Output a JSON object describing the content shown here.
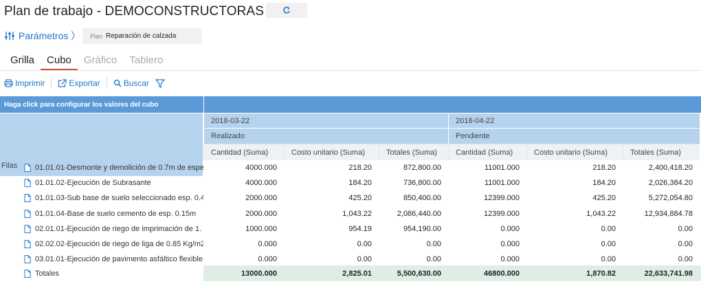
{
  "header": {
    "title": "Plan de trabajo - DEMOCONSTRUCTORAS",
    "params_label": "Parámetros 〉",
    "plan_label": "Plan",
    "plan_value": "Reparación de calzada"
  },
  "tabs": [
    {
      "label": "Grilla",
      "state": "normal"
    },
    {
      "label": "Cubo",
      "state": "active"
    },
    {
      "label": "Gráfico",
      "state": "disabled"
    },
    {
      "label": "Tablero",
      "state": "disabled"
    }
  ],
  "toolbar": {
    "print": "Imprimir",
    "export": "Exportar",
    "search": "Buscar"
  },
  "grid": {
    "config_hint": "Haga click para configurar los valores del cubo",
    "rows_header": "Filas",
    "dates": [
      "2018-03-22",
      "2018-04-22"
    ],
    "statuses": [
      "Realizado",
      "Pendiente"
    ],
    "measures": [
      "Cantidad (Suma)",
      "Costo unitario (Suma)",
      "Totales (Suma)"
    ],
    "rows": [
      {
        "label": "01.01.01-Desmonte y demolición de 0.7m de espe",
        "values": [
          "4000.000",
          "218.20",
          "872,800.00",
          "11001.000",
          "218.20",
          "2,400,418.20"
        ]
      },
      {
        "label": "01.01.02-Ejecución de Subrasante",
        "values": [
          "4000.000",
          "184.20",
          "736,800.00",
          "11001.000",
          "184.20",
          "2,026,384.20"
        ]
      },
      {
        "label": "01.01.03-Sub base de suelo seleccionado esp. 0.4",
        "values": [
          "2000.000",
          "425.20",
          "850,400.00",
          "12399.000",
          "425.20",
          "5,272,054.80"
        ]
      },
      {
        "label": "01.01.04-Base de suelo cemento de esp. 0.15m",
        "values": [
          "2000.000",
          "1,043.22",
          "2,086,440.00",
          "12399.000",
          "1,043.22",
          "12,934,884.78"
        ]
      },
      {
        "label": "02.01.01-Ejecución de riego de imprimación de 1.",
        "values": [
          "1000.000",
          "954.19",
          "954,190.00",
          "0.000",
          "0.00",
          "0.00"
        ]
      },
      {
        "label": "02.02.02-Ejecución de riego de liga de 0.85 Kg/m2",
        "values": [
          "0.000",
          "0.00",
          "0.00",
          "0.000",
          "0.00",
          "0.00"
        ]
      },
      {
        "label": "03.01.01-Ejecución de pavimento asfáltico flexible",
        "values": [
          "0.000",
          "0.00",
          "0.00",
          "0.000",
          "0.00",
          "0.00"
        ]
      }
    ],
    "totals": {
      "label": "Totales",
      "values": [
        "13000.000",
        "2,825.01",
        "5,500,630.00",
        "46800.000",
        "1,870.82",
        "22,633,741.98"
      ]
    }
  },
  "colors": {
    "accent": "#1f77c9",
    "active_tab": "#d64a3c",
    "header_dark": "#5b9ad8",
    "header_light": "#b6d3ee",
    "totals_bg": "#dfeee4"
  }
}
